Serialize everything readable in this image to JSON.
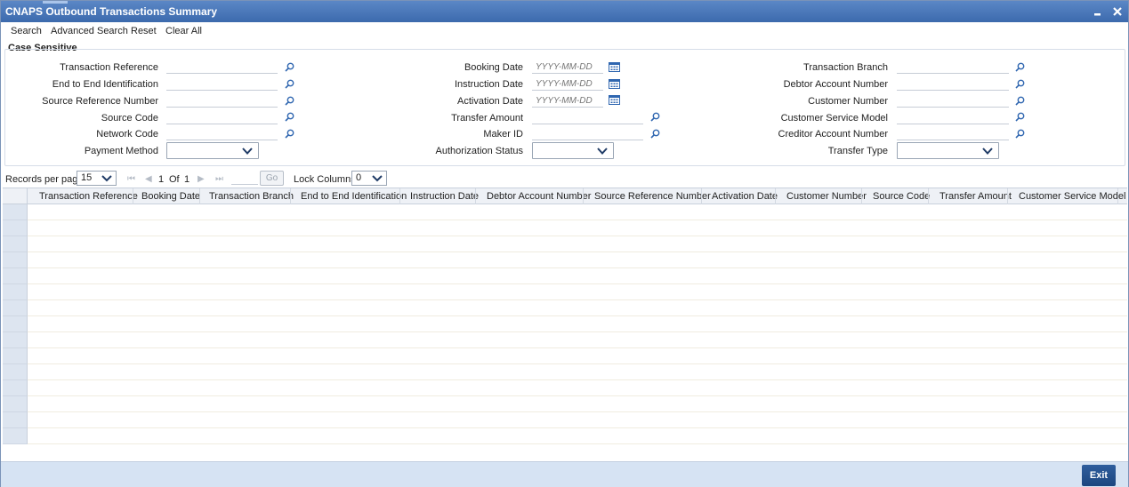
{
  "window": {
    "title": "CNAPS Outbound Transactions Summary"
  },
  "menu": {
    "search": "Search",
    "advanced_search": "Advanced Search",
    "reset": "Reset",
    "clear_all": "Clear All"
  },
  "section_title": "Case Sensitive",
  "form": {
    "col1": {
      "transaction_reference": {
        "label": "Transaction Reference",
        "value": ""
      },
      "end_to_end_identification": {
        "label": "End to End Identification",
        "value": ""
      },
      "source_reference_number": {
        "label": "Source Reference Number",
        "value": ""
      },
      "source_code": {
        "label": "Source Code",
        "value": ""
      },
      "network_code": {
        "label": "Network Code",
        "value": ""
      },
      "payment_method": {
        "label": "Payment Method",
        "value": ""
      }
    },
    "col2": {
      "booking_date": {
        "label": "Booking Date",
        "placeholder": "YYYY-MM-DD"
      },
      "instruction_date": {
        "label": "Instruction Date",
        "placeholder": "YYYY-MM-DD"
      },
      "activation_date": {
        "label": "Activation Date",
        "placeholder": "YYYY-MM-DD"
      },
      "transfer_amount": {
        "label": "Transfer Amount",
        "value": ""
      },
      "maker_id": {
        "label": "Maker ID",
        "value": ""
      },
      "authorization_status": {
        "label": "Authorization Status",
        "value": ""
      }
    },
    "col3": {
      "transaction_branch": {
        "label": "Transaction Branch",
        "value": ""
      },
      "debtor_account_number": {
        "label": "Debtor Account Number",
        "value": ""
      },
      "customer_number": {
        "label": "Customer Number",
        "value": ""
      },
      "customer_service_model": {
        "label": "Customer Service Model",
        "value": ""
      },
      "creditor_account_number": {
        "label": "Creditor Account Number",
        "value": ""
      },
      "transfer_type": {
        "label": "Transfer Type",
        "value": ""
      }
    }
  },
  "pager": {
    "records_per_page_label": "Records per page",
    "records_per_page": "15",
    "current_page": "1",
    "of_label": "Of",
    "total_pages": "1",
    "go_label": "Go",
    "lock_columns_label": "Lock Columns",
    "lock_columns": "0"
  },
  "grid": {
    "columns": [
      "Transaction Reference",
      "Booking Date",
      "Transaction Branch",
      "End to End Identification",
      "Instruction Date",
      "Debtor Account Number",
      "Source Reference Number",
      "Activation Date",
      "Customer Number",
      "Source Code",
      "Transfer Amount",
      "Customer Service Model"
    ],
    "rows": []
  },
  "footer": {
    "exit_label": "Exit"
  },
  "colors": {
    "title_bar": "#3c6aad",
    "footer": "#d6e3f3",
    "exit_button": "#1c467f",
    "row_header": "#dde5f0"
  },
  "icons": {
    "search_lens": "search-icon",
    "calendar": "calendar-icon",
    "dropdown": "chevron-down-icon"
  }
}
